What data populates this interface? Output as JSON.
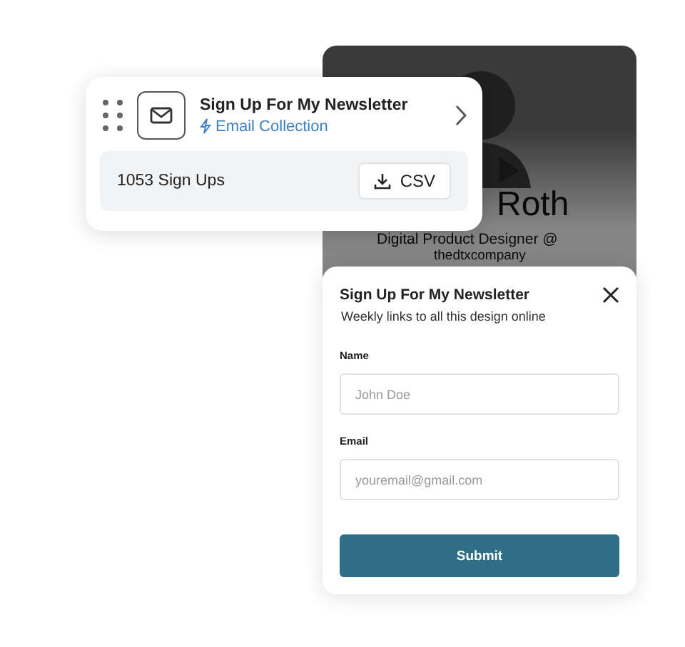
{
  "newsletter_card": {
    "title": "Sign Up For My Newsletter",
    "subtitle": "Email Collection",
    "count": "1053 Sign Ups",
    "export_button": "CSV"
  },
  "profile_card": {
    "name": "Roth",
    "headline": "Digital Product Designer @",
    "company": "thedtxcompany"
  },
  "signup_form": {
    "title": "Sign Up For My Newsletter",
    "subtitle": "Weekly links to all this design online",
    "fields": [
      {
        "label": "Name",
        "placeholder": "John Doe"
      },
      {
        "label": "Email",
        "placeholder": "youremail@gmail.com"
      }
    ],
    "submit_button": "Submit"
  }
}
